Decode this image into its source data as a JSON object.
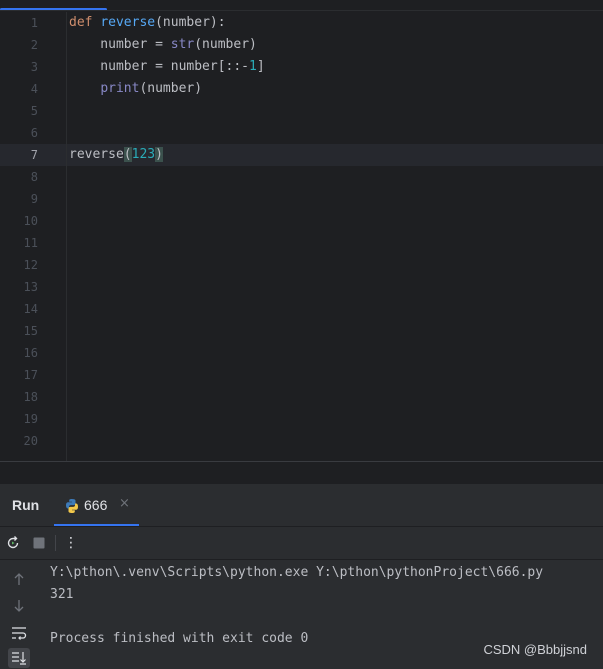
{
  "editor": {
    "line_numbers": [
      "1",
      "2",
      "3",
      "4",
      "5",
      "6",
      "7",
      "8",
      "9",
      "10",
      "11",
      "12",
      "13",
      "14",
      "15",
      "16",
      "17",
      "18",
      "19",
      "20"
    ],
    "current_line": "7",
    "code": {
      "l1_kw": "def",
      "l1_fn": "reverse",
      "l1_rest": "(number):",
      "l2_pre": "    number = ",
      "l2_bi": "str",
      "l2_post": "(number)",
      "l3_pre": "    number = number[::-",
      "l3_num": "1",
      "l3_post": "]",
      "l4_indent": "    ",
      "l4_bi": "print",
      "l4_post": "(number)",
      "l7_fn": "reverse",
      "l7_open": "(",
      "l7_num": "123",
      "l7_close": ")"
    }
  },
  "run_panel": {
    "title": "Run",
    "tab_label": "666",
    "tab_close": "×",
    "console": [
      "Y:\\pthon\\.venv\\Scripts\\python.exe Y:\\pthon\\pythonProject\\666.py",
      "321",
      "",
      "Process finished with exit code 0"
    ],
    "more_label": "⋮"
  },
  "icons": {
    "rerun": "rerun-icon",
    "stop": "stop-icon",
    "up": "arrow-up-icon",
    "down": "arrow-down-icon",
    "wrap": "soft-wrap-icon",
    "scroll": "scroll-to-end-icon"
  },
  "colors": {
    "accent": "#3574f0",
    "keyword": "#cf8e6d",
    "function": "#56a8f5",
    "builtin": "#8888c6",
    "number": "#2aacb8"
  },
  "watermark": "CSDN @Bbbjjsnd"
}
